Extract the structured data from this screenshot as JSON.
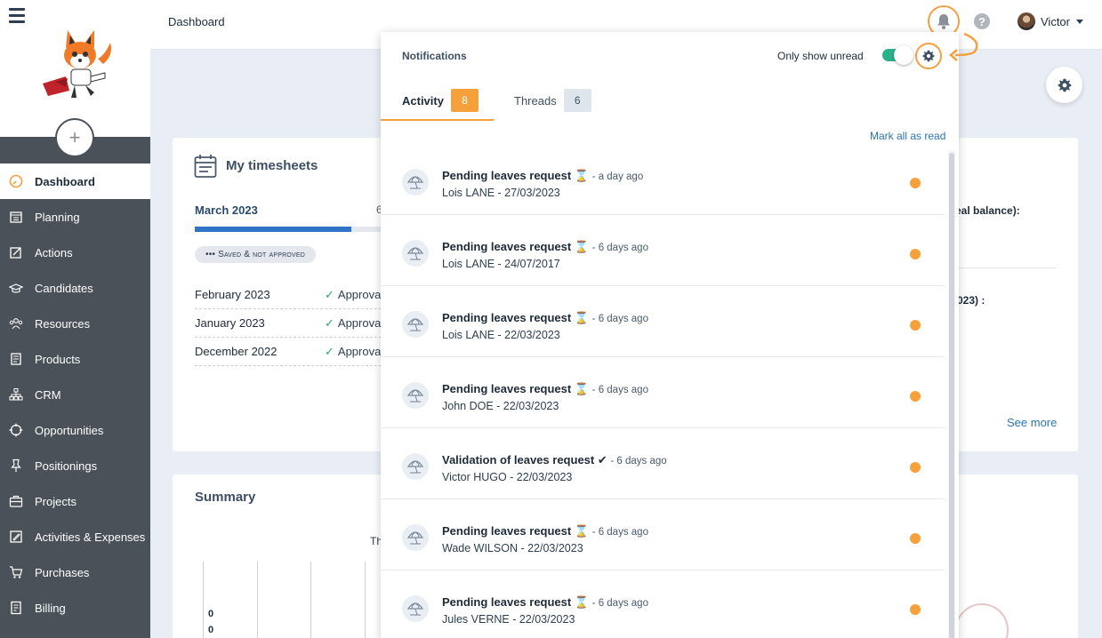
{
  "sidebar": {
    "items": [
      {
        "label": "Dashboard",
        "icon": "dashboard-icon",
        "active": true
      },
      {
        "label": "Planning",
        "icon": "planning-icon"
      },
      {
        "label": "Actions",
        "icon": "actions-icon"
      },
      {
        "label": "Candidates",
        "icon": "candidates-icon"
      },
      {
        "label": "Resources",
        "icon": "resources-icon"
      },
      {
        "label": "Products",
        "icon": "products-icon"
      },
      {
        "label": "CRM",
        "icon": "crm-icon"
      },
      {
        "label": "Opportunities",
        "icon": "opportunities-icon"
      },
      {
        "label": "Positionings",
        "icon": "positionings-icon"
      },
      {
        "label": "Projects",
        "icon": "projects-icon"
      },
      {
        "label": "Activities & Expenses",
        "icon": "activities-icon"
      },
      {
        "label": "Purchases",
        "icon": "purchases-icon"
      },
      {
        "label": "Billing",
        "icon": "billing-icon"
      }
    ],
    "add_label": "+"
  },
  "header": {
    "title": "Dashboard",
    "help_label": "?",
    "user_name": "Victor"
  },
  "timesheets": {
    "title": "My timesheets",
    "current_month": "March 2023",
    "current_count": "6",
    "progress": 0.8,
    "status": "••• Saved & not approved",
    "rows": [
      {
        "month": "February 2023",
        "status": "Approva"
      },
      {
        "month": "January 2023",
        "status": "Approva"
      },
      {
        "month": "December 2022",
        "status": "Approva"
      }
    ]
  },
  "right_panel": {
    "text1": "eal balance):",
    "text2": "023) :",
    "see_more": "See more"
  },
  "summary": {
    "title": "Summary",
    "chart_fragment": "Th",
    "zero_labels": [
      "0",
      "0"
    ]
  },
  "notifications": {
    "title": "Notifications",
    "only_unread_label": "Only show unread",
    "only_unread_on": true,
    "tabs": [
      {
        "label": "Activity",
        "count": "8",
        "active": true
      },
      {
        "label": "Threads",
        "count": "6"
      }
    ],
    "mark_all_label": "Mark all as read",
    "items": [
      {
        "title": "Pending leaves request",
        "glyph": "⌛",
        "time": "- a day ago",
        "subtitle": "Lois LANE - 27/03/2023"
      },
      {
        "title": "Pending leaves request",
        "glyph": "⌛",
        "time": "- 6 days ago",
        "subtitle": "Lois LANE - 24/07/2017"
      },
      {
        "title": "Pending leaves request",
        "glyph": "⌛",
        "time": "- 6 days ago",
        "subtitle": "Lois LANE - 22/03/2023"
      },
      {
        "title": "Pending leaves request",
        "glyph": "⌛",
        "time": "- 6 days ago",
        "subtitle": "John DOE - 22/03/2023"
      },
      {
        "title": "Validation of leaves request",
        "glyph": "✔",
        "time": "- 6 days ago",
        "subtitle": "Victor HUGO - 22/03/2023"
      },
      {
        "title": "Pending leaves request",
        "glyph": "⌛",
        "time": "- 6 days ago",
        "subtitle": "Wade WILSON - 22/03/2023"
      },
      {
        "title": "Pending leaves request",
        "glyph": "⌛",
        "time": "- 6 days ago",
        "subtitle": "Jules VERNE - 22/03/2023"
      }
    ]
  },
  "colors": {
    "sidebar_bg": "#4a5158",
    "accent_orange": "#f5a03a",
    "toggle_green": "#2ab08a",
    "link_blue": "#2a74b5"
  }
}
